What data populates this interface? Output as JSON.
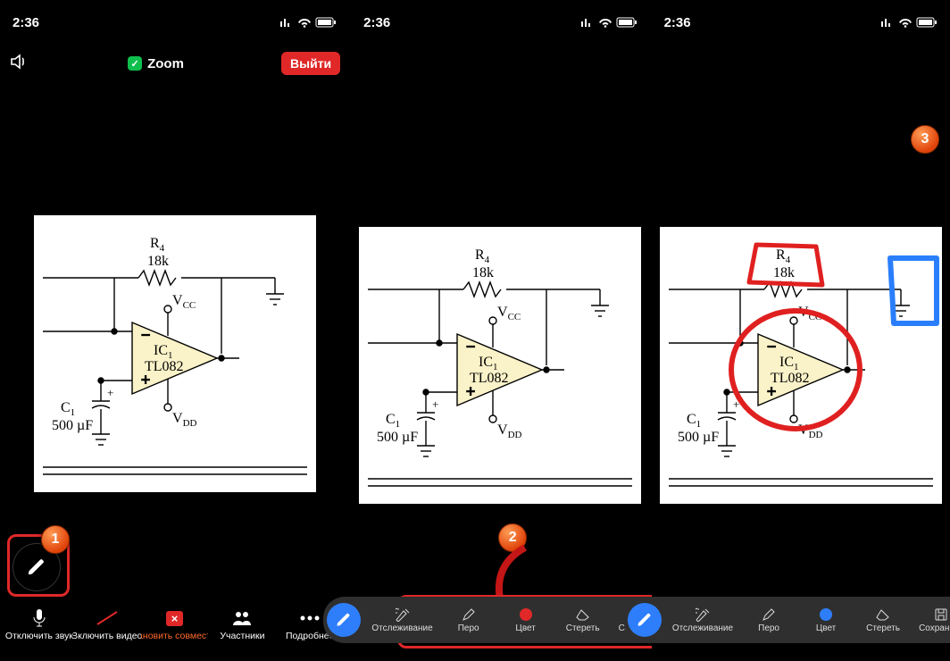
{
  "status_time": "2:36",
  "app_name": "Zoom",
  "exit_label": "Выйти",
  "bottom_nav": {
    "mic": "Отключить звук",
    "video": "Включить видео",
    "share": "Остановить совместный",
    "participants": "Участники",
    "more": "Подробнее"
  },
  "toolbar": {
    "spotlight": "Отслеживание",
    "pen": "Перо",
    "color": "Цвет",
    "erase": "Стереть",
    "save": "Сохранить"
  },
  "markers": {
    "m1": "1",
    "m2": "2",
    "m3": "3"
  },
  "circuit": {
    "r4": "R",
    "r4_sub": "4",
    "r4_val": "18k",
    "vcc": "V",
    "vcc_sub": "CC",
    "ic": "IC",
    "ic_sub": "1",
    "ic_part": "TL082",
    "vdd": "V",
    "vdd_sub": "DD",
    "c1": "C",
    "c1_sub": "1",
    "c1_val": "500 µF"
  }
}
